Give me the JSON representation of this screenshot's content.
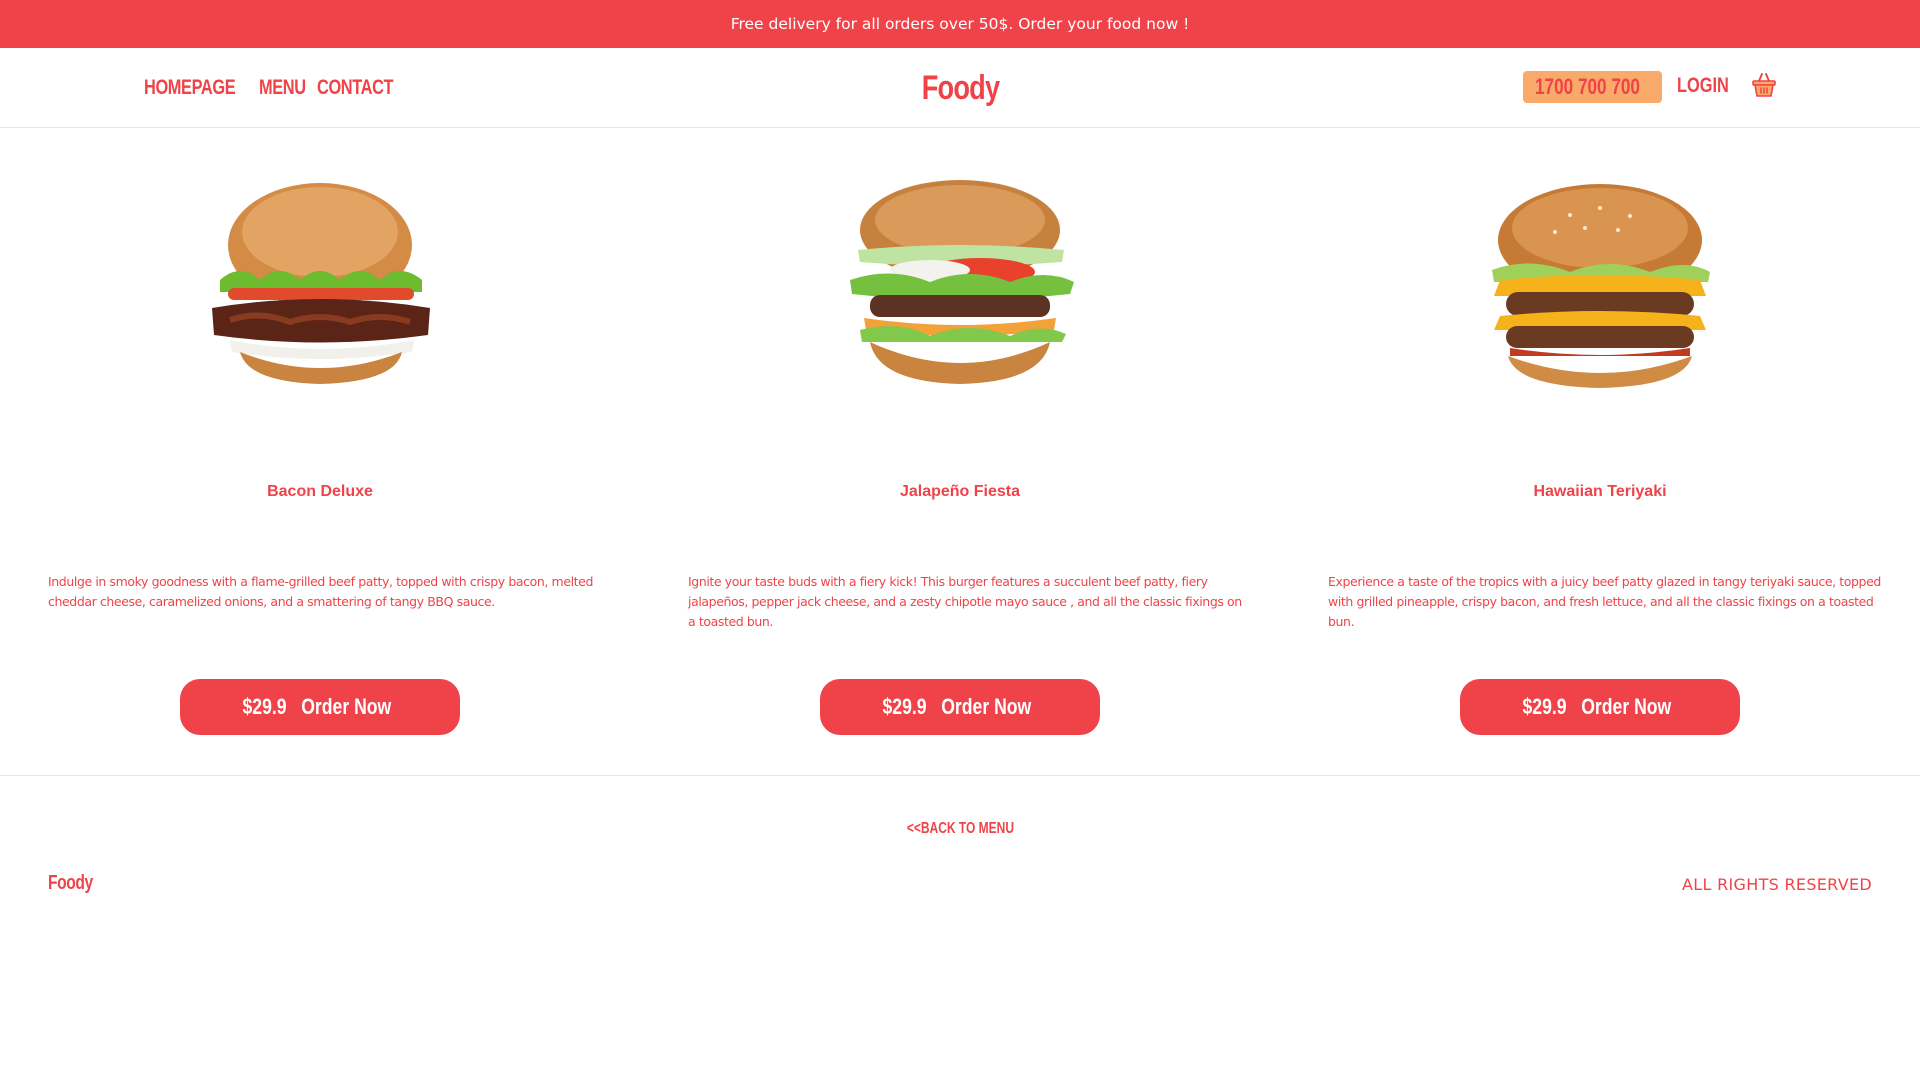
{
  "topbar": {
    "text": "Free delivery for all orders over 50$. Order your food now !"
  },
  "nav": {
    "links": [
      "HOMEPAGE",
      "MENU",
      "CONTACT"
    ],
    "logo": "Foody",
    "phone": "1700 700 700",
    "login": "LOGIN",
    "phone_icon": "phone-icon",
    "cart_icon": "basket-icon"
  },
  "products": [
    {
      "name": "Bacon Deluxe",
      "description": "Indulge in smoky goodness with a flame-grilled beef patty, topped with crispy bacon, melted cheddar cheese, caramelized onions, and a smattering of tangy BBQ sauce.",
      "price": "$29.9",
      "button_label": "Order Now"
    },
    {
      "name": "Jalapeño Fiesta",
      "description": "Ignite your taste buds with a fiery kick! This burger features a succulent beef patty, fiery jalapeños, pepper jack cheese, and a zesty chipotle mayo sauce , and all the classic fixings on a toasted bun.",
      "price": "$29.9",
      "button_label": "Order Now"
    },
    {
      "name": "Hawaiian Teriyaki",
      "description": "Experience a taste of the tropics with a juicy beef patty glazed in tangy teriyaki sauce, topped with grilled pineapple, crispy bacon, and fresh lettuce, and all the classic fixings on a toasted bun.",
      "price": "$29.9",
      "button_label": "Order Now"
    }
  ],
  "back_link": "<<BACK TO MENU",
  "footer": {
    "logo": "Foody",
    "rights": "ALL RIGHTS RESERVED"
  },
  "colors": {
    "brand_red": "#f04349",
    "phone_pill": "#f9a96a",
    "white": "#ffffff"
  }
}
